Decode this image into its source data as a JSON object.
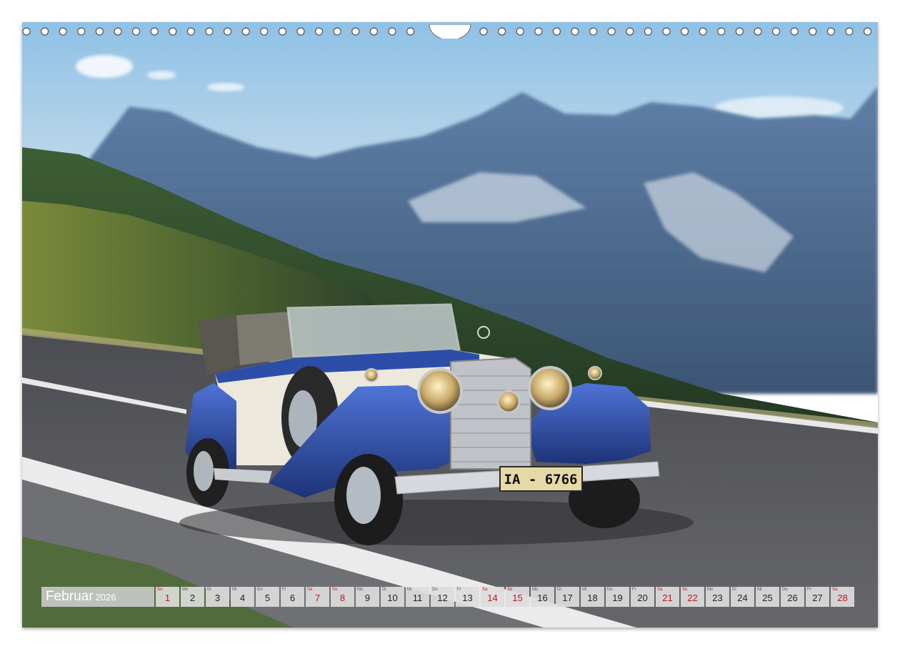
{
  "calendar": {
    "month": "Februar",
    "year": "2026",
    "days": [
      {
        "wd": "So",
        "num": "1",
        "weekend": true
      },
      {
        "wd": "Mo",
        "num": "2",
        "weekend": false
      },
      {
        "wd": "Di",
        "num": "3",
        "weekend": false
      },
      {
        "wd": "Mi",
        "num": "4",
        "weekend": false
      },
      {
        "wd": "Do",
        "num": "5",
        "weekend": false
      },
      {
        "wd": "Fr",
        "num": "6",
        "weekend": false
      },
      {
        "wd": "Sa",
        "num": "7",
        "weekend": true
      },
      {
        "wd": "So",
        "num": "8",
        "weekend": true
      },
      {
        "wd": "Mo",
        "num": "9",
        "weekend": false
      },
      {
        "wd": "Di",
        "num": "10",
        "weekend": false
      },
      {
        "wd": "Mi",
        "num": "11",
        "weekend": false
      },
      {
        "wd": "Do",
        "num": "12",
        "weekend": false
      },
      {
        "wd": "Fr",
        "num": "13",
        "weekend": false
      },
      {
        "wd": "Sa",
        "num": "14",
        "weekend": true
      },
      {
        "wd": "So",
        "num": "15",
        "weekend": true
      },
      {
        "wd": "Mo",
        "num": "16",
        "weekend": false
      },
      {
        "wd": "Di",
        "num": "17",
        "weekend": false
      },
      {
        "wd": "Mi",
        "num": "18",
        "weekend": false
      },
      {
        "wd": "Do",
        "num": "19",
        "weekend": false
      },
      {
        "wd": "Fr",
        "num": "20",
        "weekend": false
      },
      {
        "wd": "Sa",
        "num": "21",
        "weekend": true
      },
      {
        "wd": "So",
        "num": "22",
        "weekend": true
      },
      {
        "wd": "Mo",
        "num": "23",
        "weekend": false
      },
      {
        "wd": "Di",
        "num": "24",
        "weekend": false
      },
      {
        "wd": "Mi",
        "num": "25",
        "weekend": false
      },
      {
        "wd": "Do",
        "num": "26",
        "weekend": false
      },
      {
        "wd": "Fr",
        "num": "27",
        "weekend": false
      },
      {
        "wd": "Sa",
        "num": "28",
        "weekend": true
      }
    ]
  },
  "photo": {
    "license_plate": "IA - 6766"
  },
  "colors": {
    "weekend": "#c0151d",
    "car_blue": "#2c4ea8",
    "car_cream": "#ece8dc"
  }
}
